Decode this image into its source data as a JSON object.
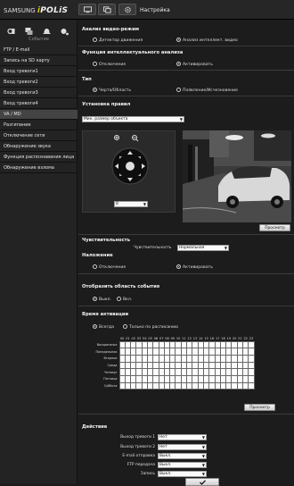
{
  "header": {
    "brand_a": "SAMSUNG ",
    "brand_b": "i",
    "brand_c": "POLiS",
    "settings": "Настройка"
  },
  "sidebar": {
    "title": "Событие",
    "items": [
      {
        "label": "FTP / E-mail"
      },
      {
        "label": "Запись на SD карту"
      },
      {
        "label": "Вход тревоги1"
      },
      {
        "label": "Вход тревоги2"
      },
      {
        "label": "Вход тревоги3"
      },
      {
        "label": "Вход тревоги4"
      },
      {
        "label": "VA / MD",
        "active": true
      },
      {
        "label": "Разгипание"
      },
      {
        "label": "Отключение сети"
      },
      {
        "label": "Обнаружение звука"
      },
      {
        "label": "Функция распознавания лица"
      },
      {
        "label": "Обнаружение взлома"
      }
    ]
  },
  "video_mode": {
    "title": "Анализ видео-режим",
    "opt1": "Детектор движения",
    "opt2": "Анализ интеллект. видео",
    "selected": 2
  },
  "intel": {
    "title": "Функция интеллектуального анализа",
    "opt1": "Отключение",
    "opt2": "Активировать"
  },
  "type": {
    "title": "Тип",
    "opt1": "Черта/Область",
    "opt2": "Появление/Исчезновение"
  },
  "rules": {
    "title": "Установка правил",
    "object_select": "Мин. размер объекта",
    "zoom_select": "8",
    "preview_btn": "Просмотр"
  },
  "sensitivity": {
    "title": "Чувствительность",
    "label": "Чувствительность",
    "value": "Нормальная"
  },
  "overlay": {
    "title": "Наложение",
    "opt1": "Отключение",
    "opt2": "Активировать"
  },
  "display_area": {
    "title": "Отобразить область события",
    "opt1": "Выкл.",
    "opt2": "Вкл."
  },
  "schedule": {
    "title": "Время активации",
    "opt1": "Всегда",
    "opt2": "Только по расписанию",
    "hours": [
      "00",
      "01",
      "02",
      "03",
      "04",
      "05",
      "06",
      "07",
      "08",
      "09",
      "10",
      "11",
      "12",
      "13",
      "14",
      "15",
      "16",
      "17",
      "18",
      "19",
      "20",
      "21",
      "22",
      "23"
    ],
    "days": [
      "Воскресенье",
      "Понедельник",
      "Вторник",
      "Среда",
      "Четверг",
      "Пятница",
      "Суббота"
    ],
    "preview_btn": "Просмотр"
  },
  "action": {
    "title": "Действие",
    "rows": [
      {
        "label": "Выход тревоги 1",
        "value": "Нет"
      },
      {
        "label": "Выход тревоги 2",
        "value": "Нет"
      },
      {
        "label": "E-mail отправка",
        "value": "Выкл."
      },
      {
        "label": "FTP передача",
        "value": "Выкл."
      },
      {
        "label": "Запись",
        "value": "Выкл."
      }
    ],
    "apply_icon": "check-icon"
  }
}
